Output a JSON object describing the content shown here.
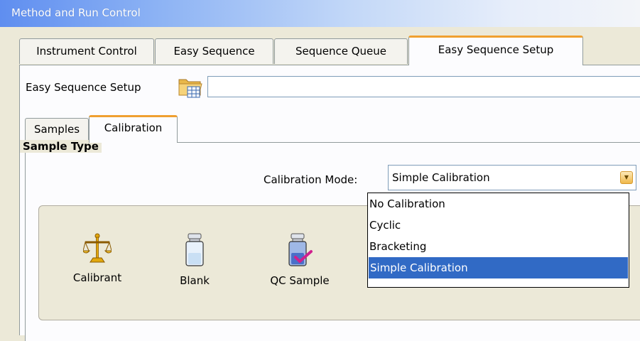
{
  "window": {
    "title": "Method and Run Control"
  },
  "tabs": [
    {
      "label": "Instrument Control",
      "active": false
    },
    {
      "label": "Easy Sequence",
      "active": false
    },
    {
      "label": "Sequence Queue",
      "active": false
    },
    {
      "label": "Easy Sequence Setup",
      "active": true
    }
  ],
  "easy_sequence_setup": {
    "label": "Easy Sequence Setup",
    "icon": "open-folder-icon",
    "value": ""
  },
  "sub_tabs": [
    {
      "label": "Samples",
      "active": false
    },
    {
      "label": "Calibration",
      "active": true
    }
  ],
  "calibration": {
    "mode_label": "Calibration Mode:",
    "selected": "Simple Calibration",
    "options": [
      "No Calibration",
      "Cyclic",
      "Bracketing",
      "Simple Calibration"
    ]
  },
  "sample_type": {
    "legend": "Sample Type",
    "items": [
      {
        "label": "Calibrant",
        "icon": "balance-scale-icon"
      },
      {
        "label": "Blank",
        "icon": "vial-icon"
      },
      {
        "label": "QC Sample",
        "icon": "vial-check-icon"
      }
    ]
  },
  "colors": {
    "accent_tab": "#f0a030",
    "selection": "#316ac5",
    "title_bar": "#5f8ef0"
  }
}
